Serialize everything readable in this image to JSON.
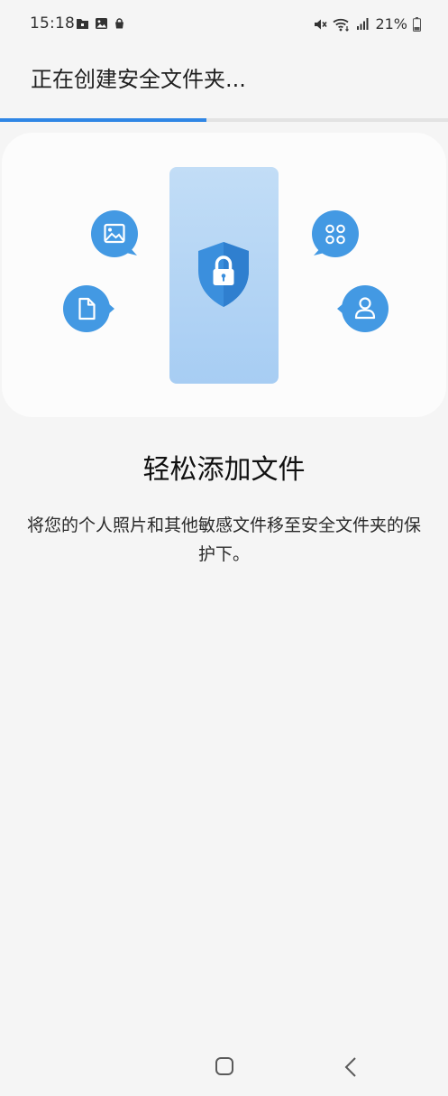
{
  "status_bar": {
    "time": "15:18",
    "left_icons": [
      "folder-icon",
      "image-icon",
      "shopping-bag-icon"
    ],
    "right_icons": [
      "mute-icon",
      "wifi-icon",
      "signal-icon",
      "battery-icon"
    ],
    "battery_percent": "21%"
  },
  "header": {
    "title": "正在创建安全文件夹..."
  },
  "progress": {
    "fraction": 0.46
  },
  "illustration": {
    "icons": [
      "image-icon",
      "file-icon",
      "apps-grid-icon",
      "person-icon",
      "shield-lock-icon"
    ],
    "accent_color": "#4399e3"
  },
  "content": {
    "headline": "轻松添加文件",
    "description": "将您的个人照片和其他敏感文件移至安全文件夹的保护下。"
  },
  "nav_bar": {
    "icons": [
      "home-icon",
      "back-icon"
    ]
  }
}
